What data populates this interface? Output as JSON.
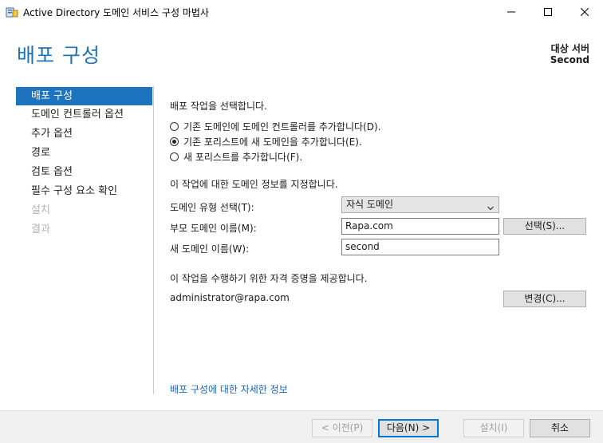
{
  "window": {
    "title": "Active Directory 도메인 서비스 구성 마법사"
  },
  "header": {
    "page_title": "배포 구성",
    "target_label": "대상 서버",
    "target_value": "Second"
  },
  "nav": {
    "items": [
      {
        "label": "배포 구성"
      },
      {
        "label": "도메인 컨트롤러 옵션"
      },
      {
        "label": "추가 옵션"
      },
      {
        "label": "경로"
      },
      {
        "label": "검토 옵션"
      },
      {
        "label": "필수 구성 요소 확인"
      },
      {
        "label": "설치"
      },
      {
        "label": "결과"
      }
    ]
  },
  "main": {
    "deploy_prompt": "배포 작업을 선택합니다.",
    "options": [
      {
        "label": "기존 도메인에 도메인 컨트롤러를 추가합니다(D)."
      },
      {
        "label": "기존 포리스트에 새 도메인을 추가합니다(E)."
      },
      {
        "label": "새 포리스트를 추가합니다(F)."
      }
    ],
    "selected_option": 1,
    "domain_info_prompt": "이 작업에 대한 도메인 정보를 지정합니다.",
    "domain_type_label": "도메인 유형 선택(T):",
    "domain_type_value": "자식 도메인",
    "parent_domain_label": "부모 도메인 이름(M):",
    "parent_domain_value": "Rapa.com",
    "select_button": "선택(S)...",
    "new_domain_label": "새 도메인 이름(W):",
    "new_domain_value": "second",
    "credentials_prompt": "이 작업을 수행하기 위한 자격 증명을 제공합니다.",
    "credential_user": "administrator@rapa.com",
    "change_button": "변경(C)...",
    "more_info_link": "배포 구성에 대한 자세한 정보"
  },
  "footer": {
    "prev": "< 이전(P)",
    "next": "다음(N) >",
    "install": "설치(I)",
    "cancel": "취소"
  },
  "colors": {
    "accent": "#1e73be",
    "title": "#1e73b8",
    "link": "#1565c0"
  },
  "icons": [
    "server-wizard-icon",
    "minimize-icon",
    "maximize-icon",
    "close-icon",
    "chevron-down-icon"
  ]
}
